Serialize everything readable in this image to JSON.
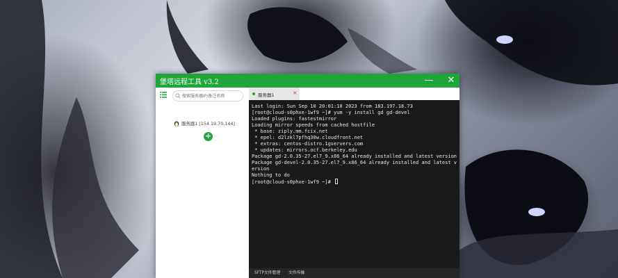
{
  "window": {
    "title": "堡塔远程工具 v3.2",
    "minimize_symbol": "—",
    "close_symbol": "✕",
    "accent_color": "#20a53a"
  },
  "sidebar": {
    "menu_icon": "list-icon",
    "search_placeholder": "搜索服务器IP/备注名称",
    "servers": [
      {
        "label": "服务器1 [154.19.70.144]",
        "icon": "linux-penguin-icon"
      }
    ],
    "add_symbol": "+"
  },
  "tabs": [
    {
      "label": "服务器1",
      "status_color": "#20a53a",
      "close_symbol": "×",
      "close_color": "#e0383e"
    }
  ],
  "terminal": {
    "lines": [
      "Last login: Sun Sep 10 20:01:10 2023 from 183.197.18.73",
      "[root@cloud-s0phxe-1wf9 ~]# yum -y install gd gd-devel",
      "Loaded plugins: fastestmirror",
      "Loading mirror speeds from cached hostfile",
      " * base: ziply.mm.fcix.net",
      " * epel: d2lzkl7pfhq30w.cloudfront.net",
      " * extras: centos-distro.1gservers.com",
      " * updates: mirrors.ocf.berkeley.edu",
      "Package gd-2.0.35-27.el7_9.x86_64 already installed and latest version",
      "Package gd-devel-2.0.35-27.el7_9.x86_64 already installed and latest v",
      "ersion",
      "Nothing to do"
    ],
    "prompt": "[root@cloud-s0phxe-1wf9 ~]# "
  },
  "bottombar": {
    "sftp_label": "SFTP文件管理",
    "files_label": "文件传输"
  }
}
